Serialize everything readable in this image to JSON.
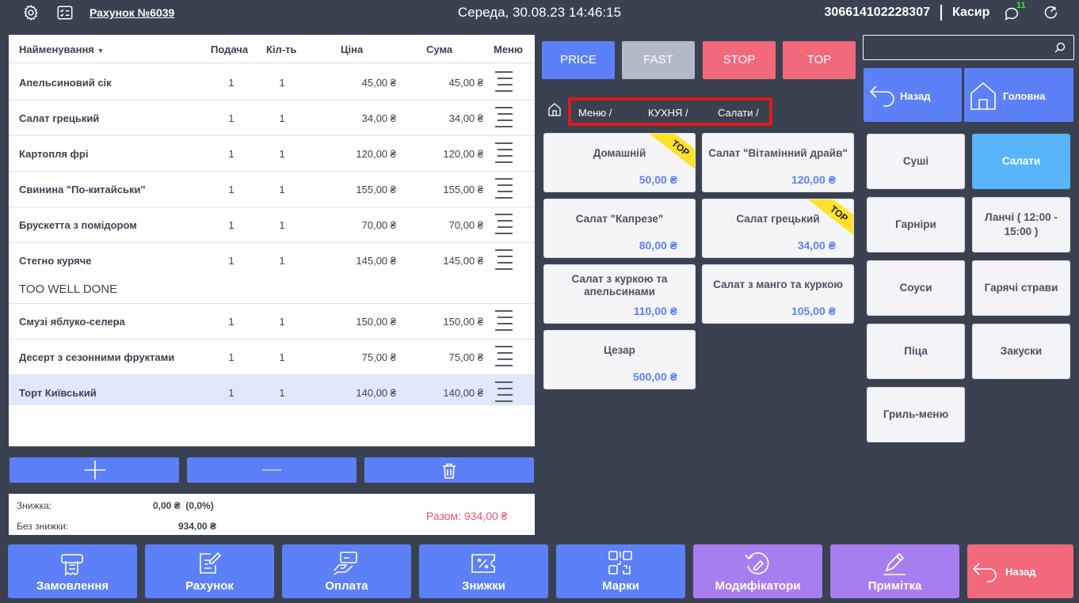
{
  "topbar": {
    "receipt_title": "Рахунок №6039",
    "datetime": "Середа, 30.08.23 14:46:15",
    "terminal_id": "306614102228307",
    "user_role": "Касир",
    "message_count": "11"
  },
  "order": {
    "columns": {
      "name": "Найменування",
      "serve": "Подача",
      "qty": "Кіл-ть",
      "price": "Ціна",
      "sum": "Сума",
      "menu": "Меню"
    },
    "rows": [
      {
        "name": "Апельсиновий сік",
        "serve": "1",
        "qty": "1",
        "price": "45,00 ₴",
        "sum": "45,00 ₴"
      },
      {
        "name": "Салат грецький",
        "serve": "1",
        "qty": "1",
        "price": "34,00 ₴",
        "sum": "34,00 ₴"
      },
      {
        "name": "Картопля фрі",
        "serve": "1",
        "qty": "1",
        "price": "120,00 ₴",
        "sum": "120,00 ₴"
      },
      {
        "name": "Свинина \"По-китайськи\"",
        "serve": "1",
        "qty": "1",
        "price": "155,00 ₴",
        "sum": "155,00 ₴"
      },
      {
        "name": "Брускетта з помідором",
        "serve": "1",
        "qty": "1",
        "price": "70,00 ₴",
        "sum": "70,00 ₴"
      },
      {
        "name": "Стегно куряче",
        "serve": "1",
        "qty": "1",
        "price": "145,00 ₴",
        "sum": "145,00 ₴",
        "note": "TOO WELL DONE"
      },
      {
        "name": "Смузі яблуко-селера",
        "serve": "1",
        "qty": "1",
        "price": "150,00 ₴",
        "sum": "150,00 ₴"
      },
      {
        "name": "Десерт з сезонними фруктами",
        "serve": "1",
        "qty": "1",
        "price": "75,00 ₴",
        "sum": "75,00 ₴"
      },
      {
        "name": "Торт Київський",
        "serve": "1",
        "qty": "1",
        "price": "140,00 ₴",
        "sum": "140,00 ₴",
        "selected": true
      }
    ]
  },
  "totals": {
    "discount_label": "Знижка:",
    "discount_value": "0,00 ₴  (0,0%)",
    "nodiscount_label": "Без знижки:",
    "nodiscount_value": "934,00 ₴",
    "total": "Разом: 934,00 ₴"
  },
  "filters": [
    "PRICE",
    "FAST",
    "STOP",
    "TOP"
  ],
  "breadcrumb": [
    "Меню  /",
    "КУХНЯ  /",
    "Салати  /"
  ],
  "products": [
    {
      "name": "Домашній",
      "price": "50,00 ₴",
      "top": true
    },
    {
      "name": "Салат \"Вітамінний драйв\"",
      "price": "120,00 ₴",
      "top": false
    },
    {
      "name": "Салат \"Капрезе\"",
      "price": "80,00 ₴",
      "top": false
    },
    {
      "name": "Салат грецький",
      "price": "34,00 ₴",
      "top": true
    },
    {
      "name": "Салат з куркою та апельсинами",
      "price": "110,00 ₴",
      "top": false
    },
    {
      "name": "Салат з манго та куркою",
      "price": "105,00 ₴",
      "top": false
    },
    {
      "name": "Цезар",
      "price": "500,00 ₴",
      "top": false
    }
  ],
  "top_ribbon": "TOP",
  "nav": {
    "back": "Назад",
    "home": "Головна"
  },
  "categories": [
    "Суші",
    "Салати",
    "Гарніри",
    "Ланчі ( 12:00 - 15:00 )",
    "Соуси",
    "Гарячі страви",
    "Піца",
    "Закуски",
    "Гриль-меню"
  ],
  "active_category": "Салати",
  "bottom": [
    "Замовлення",
    "Рахунок",
    "Оплата",
    "Знижки",
    "Марки",
    "Модифікатори",
    "Примітка",
    "Назад"
  ],
  "colors": {
    "background": "#3a4150",
    "primary": "#5c80f7",
    "danger": "#f2697b",
    "purple": "#a77ef0",
    "active_category": "#58b4fb",
    "fast": "#b4b9c9",
    "ribbon": "#ffe12a",
    "total_text": "#e8526a"
  }
}
